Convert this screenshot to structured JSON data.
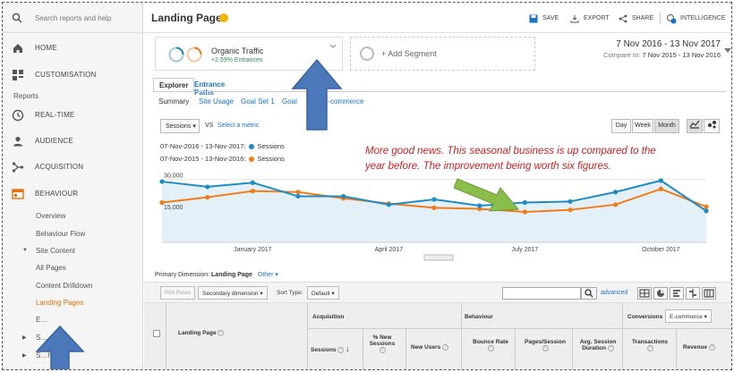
{
  "sidebar": {
    "search_placeholder": "Search reports and help",
    "top_items": [
      {
        "label": "HOME",
        "icon": "home-icon"
      },
      {
        "label": "CUSTOMISATION",
        "icon": "dashboard-grid-icon"
      }
    ],
    "section_label": "Reports",
    "report_items": [
      {
        "label": "REAL-TIME",
        "icon": "clock-icon"
      },
      {
        "label": "AUDIENCE",
        "icon": "person-icon"
      },
      {
        "label": "ACQUISITION",
        "icon": "acquisition-icon"
      },
      {
        "label": "BEHAVIOUR",
        "icon": "behaviour-icon"
      }
    ],
    "behaviour_sub": [
      "Overview",
      "Behaviour Flow"
    ],
    "site_content_label": "Site Content",
    "site_content_items": [
      "All Pages",
      "Content Drilldown",
      "Landing Pages",
      "E…"
    ],
    "collapsed_items": [
      "S…",
      "S…h"
    ]
  },
  "header": {
    "title": "Landing Pages",
    "actions": [
      {
        "label": "SAVE",
        "icon": "save-icon"
      },
      {
        "label": "EXPORT",
        "icon": "export-icon"
      },
      {
        "label": "SHARE",
        "icon": "share-icon"
      },
      {
        "label": "INTELLIGENCE",
        "icon": "intelligence-icon"
      }
    ]
  },
  "segment": {
    "name": "Organic Traffic",
    "change": "+2.59% Entrances",
    "add_label": "+ Add Segment"
  },
  "date_range": {
    "current": "7 Nov 2016 - 13 Nov 2017",
    "compare_prefix": "Compare to:",
    "compare": "7 Nov 2015 - 13 Nov 2016"
  },
  "tabs": [
    "Explorer",
    "Entrance Paths"
  ],
  "subtabs": [
    "Summary",
    "Site Usage",
    "Goal Set 1",
    "Goal",
    "E-commerce"
  ],
  "chart_controls": {
    "metric": "Sessions",
    "vs": "VS",
    "select_metric": "Select a metric",
    "periods": [
      "Day",
      "Week",
      "Month"
    ],
    "active_period": "Month"
  },
  "legend": [
    {
      "range": "07-Nov-2016 - 13-Nov-2017:",
      "series": "Sessions",
      "color": "#1f8bc3"
    },
    {
      "range": "07-Nov-2015 - 13-Nov-2016:",
      "series": "Sessions",
      "color": "#f07d1a"
    }
  ],
  "annotation": "More good news. This seasonal business is up compared to the year before. The improvement being worth six figures.",
  "chart_data": {
    "type": "line",
    "x": [
      "Nov 2016",
      "Dec 2016",
      "Jan 2017",
      "Feb 2017",
      "Mar 2017",
      "Apr 2017",
      "May 2017",
      "Jun 2017",
      "Jul 2017",
      "Aug 2017",
      "Sep 2017",
      "Oct 2017",
      "Nov 2017"
    ],
    "x_tick_labels": [
      "January 2017",
      "April 2017",
      "July 2017",
      "October 2017"
    ],
    "y_tick_labels": [
      "30,000",
      "15,000"
    ],
    "ylim": [
      0,
      35000
    ],
    "series": [
      {
        "name": "07-Nov-2016 - 13-Nov-2017: Sessions",
        "color": "#1f8bc3",
        "values": [
          29000,
          26500,
          28500,
          22000,
          22000,
          18000,
          20500,
          17500,
          19000,
          19500,
          24000,
          29500,
          15000
        ]
      },
      {
        "name": "07-Nov-2015 - 13-Nov-2016: Sessions",
        "color": "#f07d1a",
        "values": [
          19000,
          21500,
          24500,
          24000,
          21000,
          18500,
          16500,
          16000,
          14500,
          15500,
          18000,
          25500,
          17000
        ]
      }
    ]
  },
  "primary_dimension": {
    "label": "Primary Dimension:",
    "value": "Landing Page",
    "other": "Other"
  },
  "table_toolbar": {
    "plot_rows": "Plot Rows",
    "secondary_dimension": "Secondary dimension",
    "sort_type_label": "Sort Type:",
    "sort_type": "Default",
    "advanced": "advanced"
  },
  "table_header": {
    "landing_page": "Landing Page",
    "acquisition": "Acquisition",
    "behaviour": "Behaviour",
    "conversions": "Conversions",
    "conversion_type": "E-commerce",
    "columns": [
      "Sessions",
      "% New Sessions",
      "New Users",
      "Bounce Rate",
      "Pages/Session",
      "Avg. Session Duration",
      "Transactions",
      "Revenue"
    ]
  }
}
